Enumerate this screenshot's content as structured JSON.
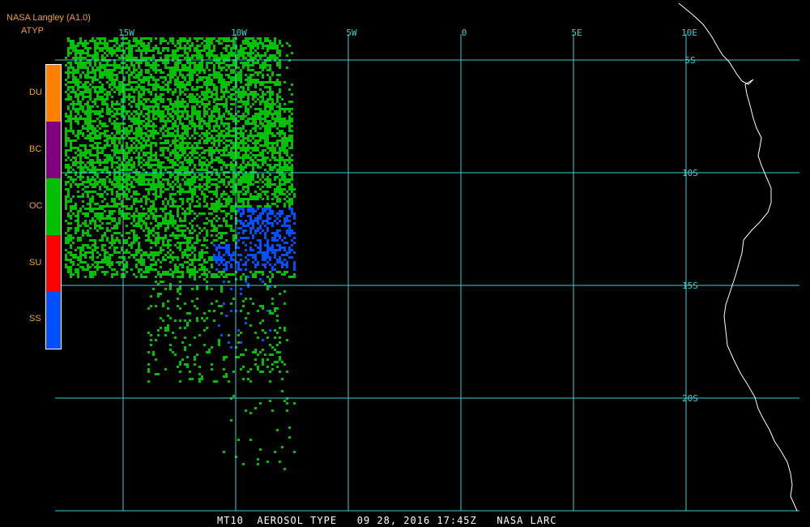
{
  "header": {
    "source": "NASA Langley (A1.0)",
    "product": "ATYP"
  },
  "map": {
    "longitude_labels": [
      "15W",
      "10W",
      "5W",
      "0",
      "5E",
      "10E"
    ],
    "latitude_labels": [
      "5S",
      "10S",
      "15S",
      "20S"
    ],
    "grid_color": "#40d0d0",
    "coast_color": "#ffffff"
  },
  "legend": {
    "items": [
      {
        "label": "DU",
        "color": "#ff8000"
      },
      {
        "label": "BC",
        "color": "#800080"
      },
      {
        "label": "OC",
        "color": "#00c000"
      },
      {
        "label": "SU",
        "color": "#ff0000"
      },
      {
        "label": "SS",
        "color": "#0050ff"
      }
    ]
  },
  "footer": {
    "text": "MT10  AEROSOL TYPE   09 28, 2016 17:45Z   NASA LARC"
  }
}
